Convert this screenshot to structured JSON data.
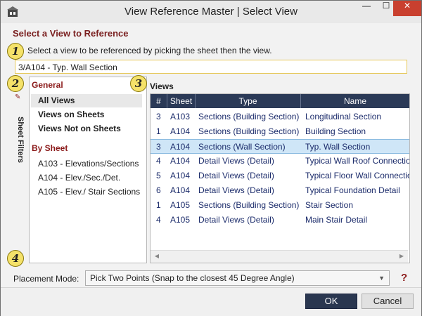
{
  "window": {
    "title": "View Reference Master | Select View"
  },
  "heading": "Select a View to Reference",
  "steps": [
    "1",
    "2",
    "3",
    "4"
  ],
  "instruction": "Select a view to be referenced by picking the sheet then the view.",
  "reference_value": "3/A104 - Typ. Wall Section",
  "left_panel": {
    "general_title": "General",
    "general_items": [
      "All Views",
      "Views on Sheets",
      "Views Not on Sheets"
    ],
    "selected_general": "All Views",
    "by_sheet_title": "By Sheet",
    "sheet_items": [
      "A103 - Elevations/Sections",
      "A104 - Elev./Sec./Det.",
      "A105 - Elev./ Stair Sections"
    ]
  },
  "sheet_filters_tab": "Sheet Filters",
  "views_label": "Views",
  "table": {
    "columns": [
      "#",
      "Sheet",
      "Type",
      "Name"
    ],
    "rows": [
      [
        "3",
        "A103",
        "Sections (Building Section)",
        "Longitudinal Section"
      ],
      [
        "1",
        "A104",
        "Sections (Building Section)",
        "Building Section"
      ],
      [
        "3",
        "A104",
        "Sections (Wall Section)",
        "Typ. Wall Section"
      ],
      [
        "4",
        "A104",
        "Detail Views (Detail)",
        "Typical Wall Roof Connection"
      ],
      [
        "5",
        "A104",
        "Detail Views (Detail)",
        "Typical Floor Wall Connection"
      ],
      [
        "6",
        "A104",
        "Detail Views (Detail)",
        "Typical Foundation Detail"
      ],
      [
        "1",
        "A105",
        "Sections (Building Section)",
        "Stair Section"
      ],
      [
        "4",
        "A105",
        "Detail Views (Detail)",
        "Main Stair Detail"
      ]
    ],
    "selected_row": 2
  },
  "placement": {
    "label": "Placement Mode:",
    "value": "Pick Two Points (Snap to the closest 45 Degree Angle)"
  },
  "buttons": {
    "ok": "OK",
    "cancel": "Cancel"
  },
  "icons": {
    "help": "?",
    "close": "✕",
    "minimize": "—",
    "maximize": "☐"
  },
  "colors": {
    "accent": "#2b3a57",
    "heading": "#7a1f1f",
    "selection": "#cfe6f7",
    "close": "#c9402f",
    "highlight": "#f5e26a"
  }
}
